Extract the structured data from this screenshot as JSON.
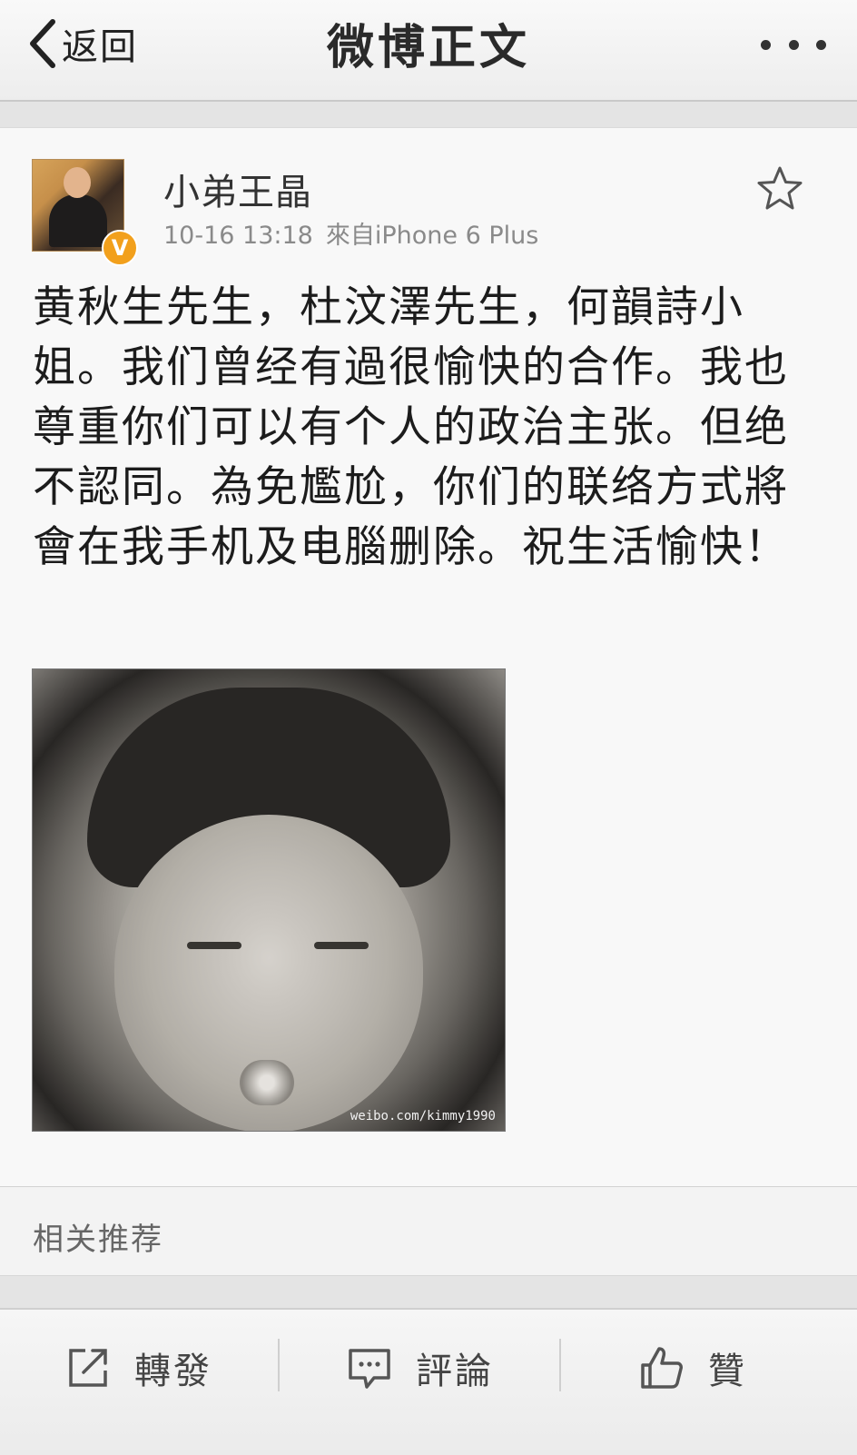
{
  "nav": {
    "back_label": "返回",
    "title": "微博正文"
  },
  "post": {
    "username": "小弟王晶",
    "time": "10-16 13:18",
    "source": "來自iPhone 6 Plus",
    "text": "黄秋生先生，杜汶澤先生，何韻詩小姐。我们曾经有過很愉快的合作。我也尊重你们可以有个人的政治主张。但绝不認同。為免尷尬，你们的联络方式將會在我手机及电腦删除。祝生活愉快！",
    "verified_badge": "V",
    "image_watermark": "weibo.com/kimmy1990"
  },
  "related": {
    "label": "相关推荐"
  },
  "toolbar": {
    "repost_label": "轉發",
    "comment_label": "評論",
    "like_label": "贊"
  },
  "icons": {
    "back": "chevron-left-icon",
    "more": "more-dots-icon",
    "favorite": "star-icon",
    "repost": "share-arrow-icon",
    "comment": "comment-bubble-icon",
    "like": "thumbs-up-icon"
  },
  "colors": {
    "verified": "#f2a01c",
    "text": "#1c1c1c",
    "meta": "#8a8a8a"
  }
}
